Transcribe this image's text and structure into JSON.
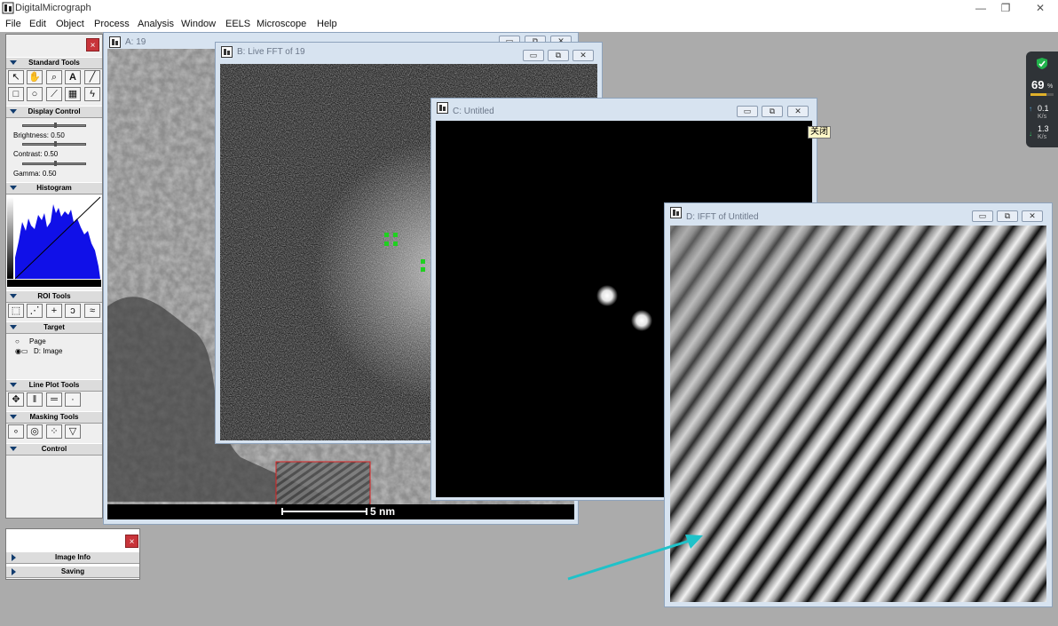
{
  "app": {
    "title": "DigitalMicrograph",
    "minimize": "—",
    "restore": "❐",
    "close": "✕"
  },
  "menu": [
    "File",
    "Edit",
    "Object",
    "Process",
    "Analysis",
    "Window",
    "EELS",
    "Microscope",
    "Help"
  ],
  "toolbox": {
    "close": "×",
    "standard_tools": "Standard Tools",
    "display_control": "Display Control",
    "brightness": "Brightness: 0.50",
    "contrast": "Contrast: 0.50",
    "gamma": "Gamma: 0.50",
    "histogram": "Histogram",
    "roi_tools": "ROI Tools",
    "target": "Target",
    "target_page": "Page",
    "target_image": "D: Image",
    "line_plot_tools": "Line Plot Tools",
    "masking_tools": "Masking Tools",
    "control": "Control"
  },
  "info_panel": {
    "close": "×",
    "image_info": "Image Info",
    "saving": "Saving"
  },
  "windows": {
    "a": {
      "title": "A: 19",
      "scale_label": "5 nm"
    },
    "b": {
      "title": "B: Live FFT of 19"
    },
    "c": {
      "title": "C: Untitled",
      "tooltip": "关闭"
    },
    "d": {
      "title": "D: IFFT of Untitled"
    }
  },
  "network_widget": {
    "percent": "69",
    "percent_unit": "%",
    "upload": "0.1",
    "download": "1.3",
    "unit": "K/s"
  },
  "colors": {
    "accent_green": "#1fd11f",
    "arrow_cyan": "#1fc2c9",
    "histogram_blue": "#1010e8",
    "widget_bg": "#2f3337"
  }
}
